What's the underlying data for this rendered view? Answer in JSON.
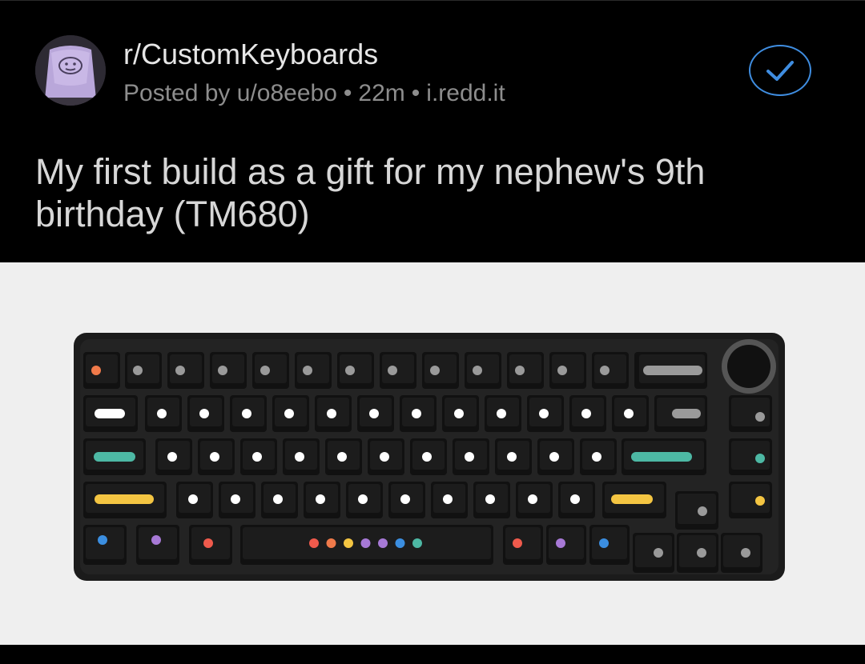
{
  "post": {
    "subreddit": "r/CustomKeyboards",
    "meta": {
      "posted_by": "Posted by u/o8eebo",
      "age": "22m",
      "domain": "i.redd.it"
    },
    "title": "My first build as a gift for my nephew's 9th birthday (TM680)",
    "avatar_icon": "keycap-avatar-icon",
    "select_icon": "checkmark-circle-icon"
  },
  "colors": {
    "background": "#000000",
    "text_primary": "#e6e6e6",
    "text_secondary": "#8d8d8d",
    "accent": "#3f8de0",
    "media_background": "#efefef",
    "keyboard_case": "#1b1b1b",
    "keycap": "#111111",
    "legend_white": "#ffffff",
    "legend_gray": "#9a9a9a",
    "legend_orange": "#f07a4a",
    "legend_teal": "#4db8a4",
    "legend_yellow": "#f4c542",
    "legend_blue": "#3b8ee0",
    "legend_purple": "#a779d6",
    "legend_red": "#ef5a4c"
  }
}
